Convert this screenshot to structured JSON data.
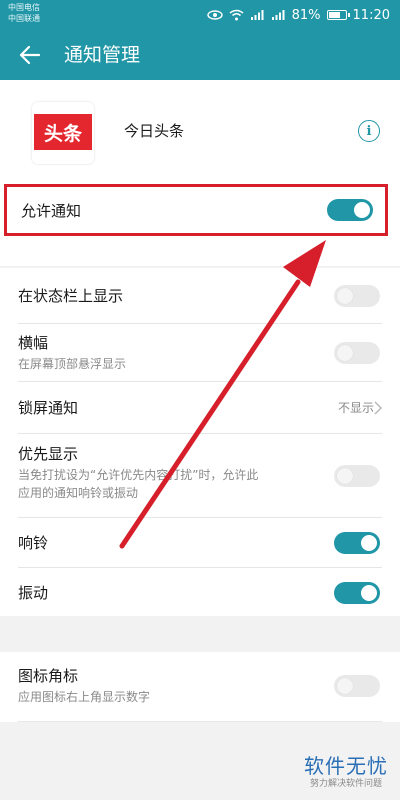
{
  "status_bar": {
    "carrier_1": "中国电信",
    "carrier_2": "中国联通",
    "battery": "81%",
    "battery_level": 0.81,
    "time": "11:20"
  },
  "header": {
    "title": "通知管理"
  },
  "app": {
    "logo_text": "头条",
    "name": "今日头条"
  },
  "allow_notifications": {
    "label": "允许通知",
    "enabled": true
  },
  "settings": [
    {
      "title": "在状态栏上显示",
      "enabled": false
    },
    {
      "title": "横幅",
      "subtitle": "在屏幕顶部悬浮显示",
      "enabled": false
    },
    {
      "title": "锁屏通知",
      "value": "不显示"
    },
    {
      "title": "优先显示",
      "subtitle_line1": "当免打扰设为“允许优先内容打扰”时，允许此",
      "subtitle_line2": "应用的通知响铃或振动",
      "enabled": false
    },
    {
      "title": "响铃",
      "enabled": true
    },
    {
      "title": "振动",
      "enabled": true
    }
  ],
  "badge": {
    "title": "图标角标",
    "subtitle": "应用图标右上角显示数字",
    "enabled": false
  },
  "watermark": {
    "main": "软件无忧",
    "sub": "努力解决软件问题"
  },
  "colors": {
    "accent": "#2196a6",
    "annotation": "#d61f2b",
    "logo_red": "#e4262e"
  }
}
